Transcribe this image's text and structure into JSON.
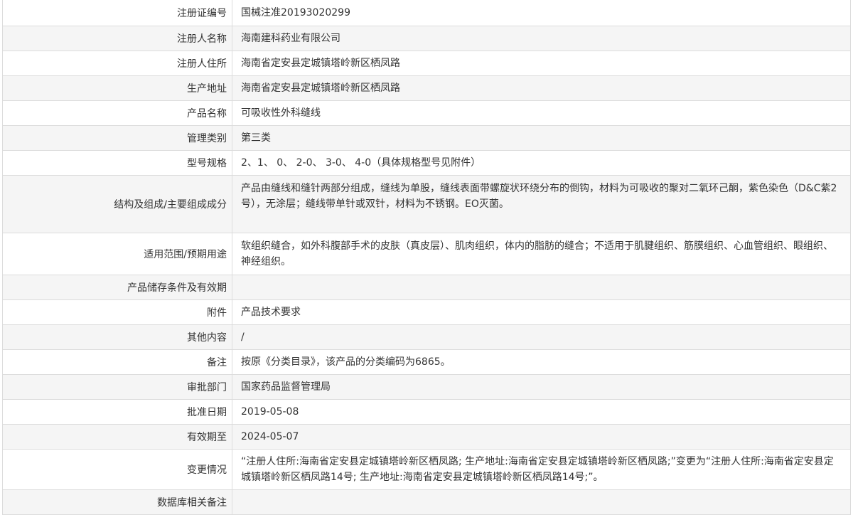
{
  "record": {
    "rows": [
      {
        "label": "注册证编号",
        "value": "国械注准20193020299"
      },
      {
        "label": "注册人名称",
        "value": "海南建科药业有限公司"
      },
      {
        "label": "注册人住所",
        "value": "海南省定安县定城镇塔岭新区栖凤路"
      },
      {
        "label": "生产地址",
        "value": "海南省定安县定城镇塔岭新区栖凤路"
      },
      {
        "label": "产品名称",
        "value": "可吸收性外科缝线"
      },
      {
        "label": "管理类别",
        "value": "第三类"
      },
      {
        "label": "型号规格",
        "value": "2、1、 0、 2-0、 3-0、 4-0（具体规格型号见附件）"
      },
      {
        "label": "结构及组成/主要组成成分",
        "value": "产品由缝线和缝针两部分组成，缝线为单股，缝线表面带螺旋状环绕分布的倒钩，材料为可吸收的聚对二氧环己酮，紫色染色（D&C紫2号），无涂层；缝线带单针或双针，材料为不锈钢。EO灭菌。"
      },
      {
        "label": "适用范围/预期用途",
        "value": "软组织缝合，如外科腹部手术的皮肤（真皮层）、肌肉组织，体内的脂肪的缝合；不适用于肌腱组织、筋膜组织、心血管组织、眼组织、神经组织。"
      },
      {
        "label": "产品储存条件及有效期",
        "value": ""
      },
      {
        "label": "附件",
        "value": "产品技术要求"
      },
      {
        "label": "其他内容",
        "value": "/"
      },
      {
        "label": "备注",
        "value": "按原《分类目录》，该产品的分类编码为6865。"
      },
      {
        "label": "审批部门",
        "value": "国家药品监督管理局"
      },
      {
        "label": "批准日期",
        "value": "2019-05-08"
      },
      {
        "label": "有效期至",
        "value": "2024-05-07"
      },
      {
        "label": "变更情况",
        "value": "“注册人住所:海南省定安县定城镇塔岭新区栖凤路; 生产地址:海南省定安县定城镇塔岭新区栖凤路;”变更为“注册人住所:海南省定安县定城镇塔岭新区栖凤路14号; 生产地址:海南省定安县定城镇塔岭新区栖凤路14号;”。"
      },
      {
        "label": "数据库相关备注",
        "value": ""
      }
    ]
  }
}
